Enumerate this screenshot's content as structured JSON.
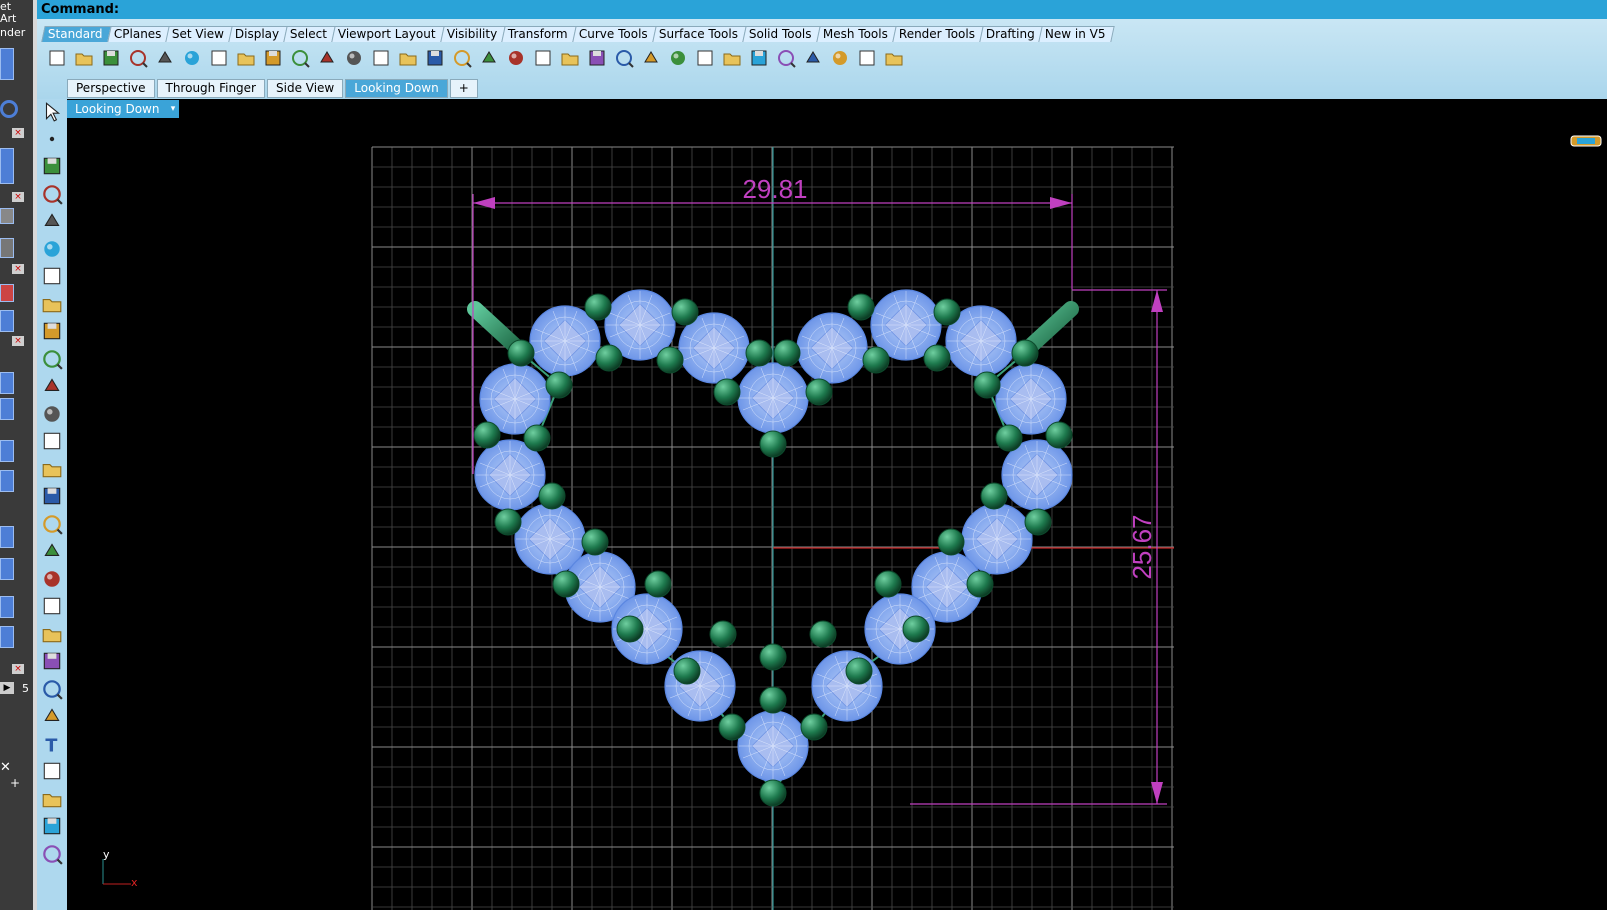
{
  "command": {
    "label": "Command:"
  },
  "toolbar_tabs": [
    "Standard",
    "CPlanes",
    "Set View",
    "Display",
    "Select",
    "Viewport Layout",
    "Visibility",
    "Transform",
    "Curve Tools",
    "Surface Tools",
    "Solid Tools",
    "Mesh Tools",
    "Render Tools",
    "Drafting",
    "New in V5"
  ],
  "active_toolbar_tab": "Standard",
  "toolbar_icons": [
    "new-icon",
    "open-icon",
    "save-icon",
    "print-icon",
    "import-icon",
    "cut-icon",
    "copy-icon",
    "paste-icon",
    "undo-icon",
    "pan-icon",
    "rotate-view-icon",
    "zoom-icon",
    "zoom-window-icon",
    "zoom-extents-icon",
    "zoom-selected-icon",
    "undo-view-icon",
    "four-viewports-icon",
    "car-icon",
    "hide-icon",
    "show-icon",
    "snap-icon",
    "light-icon",
    "lock-icon",
    "layer-icon",
    "color-wheel-icon",
    "shade-icon",
    "render-preview-icon",
    "render-icon",
    "properties-icon",
    "options-icon",
    "named-cplane-icon",
    "help-icon"
  ],
  "viewport_tabs": [
    "Perspective",
    "Through Finger",
    "Side View",
    "Looking Down"
  ],
  "active_viewport_tab": "Looking Down",
  "viewport": {
    "title": "Looking Down",
    "dropdown": "▾"
  },
  "left_toolbar_icons": [
    "select-arrow-icon",
    "point-icon",
    "polyline-icon",
    "curve-icon",
    "circle-icon",
    "ellipse-icon",
    "arc-icon",
    "rectangle-icon",
    "polygon-icon",
    "fillet-icon",
    "surface-icon",
    "extrude-icon",
    "box-icon",
    "boolean-icon",
    "cylinder-icon",
    "mesh-icon",
    "transform-icon",
    "explode-icon",
    "split-icon",
    "trim-icon",
    "group-icon",
    "move-icon",
    "rotate-icon",
    "text-icon",
    "dimension-icon",
    "array-icon",
    "analyze-icon",
    "render-mesh-icon"
  ],
  "left_strip": {
    "line1": "et",
    "line2": "Art",
    "line3": "nder",
    "spin": "5"
  },
  "dimensions": {
    "width": "29.81",
    "height": "25.67"
  },
  "axes": {
    "y": "y",
    "x": "x"
  },
  "colors": {
    "command_bar": "#2aa3d8",
    "accent": "#4aa7d8",
    "dimension": "#c040c0",
    "gem": "#7fa6ee",
    "prong": "#1e7a4e",
    "grid": "#5a5a5a"
  }
}
